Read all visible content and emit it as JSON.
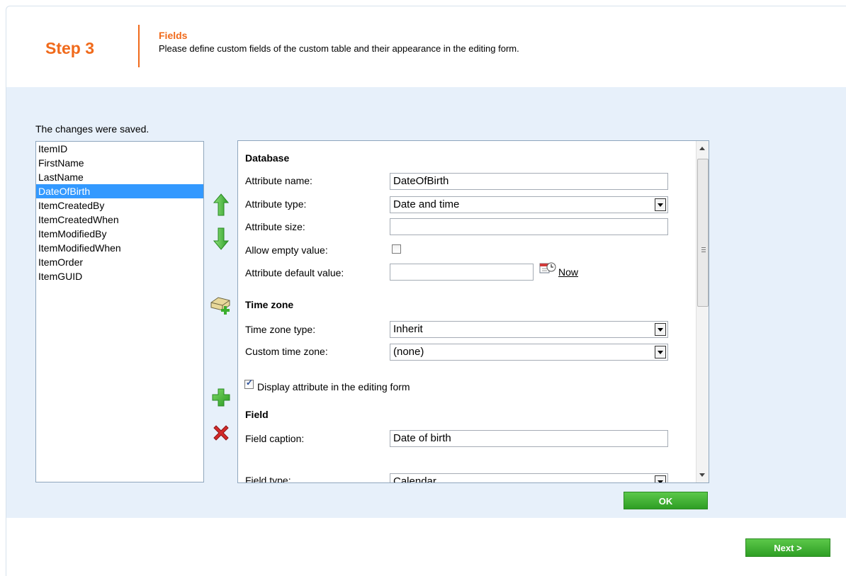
{
  "header": {
    "step": "Step 3",
    "title": "Fields",
    "description": "Please define custom fields of the custom table and their appearance in the editing form."
  },
  "status_message": "The changes were saved.",
  "field_list": {
    "items": [
      "ItemID",
      "FirstName",
      "LastName",
      "DateOfBirth",
      "ItemCreatedBy",
      "ItemCreatedWhen",
      "ItemModifiedBy",
      "ItemModifiedWhen",
      "ItemOrder",
      "ItemGUID"
    ],
    "selected": "DateOfBirth"
  },
  "toolbar": {
    "move_up": "arrow-up-icon",
    "move_down": "arrow-down-icon",
    "new_category": "new-category-icon",
    "add_field": "plus-icon",
    "delete_field": "delete-icon"
  },
  "form": {
    "database": {
      "heading": "Database",
      "attribute_name_label": "Attribute name:",
      "attribute_name_value": "DateOfBirth",
      "attribute_type_label": "Attribute type:",
      "attribute_type_value": "Date and time",
      "attribute_size_label": "Attribute size:",
      "attribute_size_value": "",
      "allow_empty_label": "Allow empty value:",
      "allow_empty_checked": false,
      "default_value_label": "Attribute default value:",
      "default_value": "",
      "now_link": "Now"
    },
    "time_zone": {
      "heading": "Time zone",
      "type_label": "Time zone type:",
      "type_value": "Inherit",
      "custom_label": "Custom time zone:",
      "custom_value": "(none)"
    },
    "display_in_form_label": "Display attribute in the editing form",
    "display_in_form_checked": true,
    "field": {
      "heading": "Field",
      "caption_label": "Field caption:",
      "caption_value": "Date of birth",
      "type_label": "Field type:",
      "type_value": "Calendar"
    }
  },
  "buttons": {
    "ok": "OK",
    "next": "Next >"
  },
  "colors": {
    "accent_orange": "#f06a1b",
    "content_bg": "#e7f0fa",
    "selection": "#3399ff",
    "button_green": "#3aae2e"
  }
}
